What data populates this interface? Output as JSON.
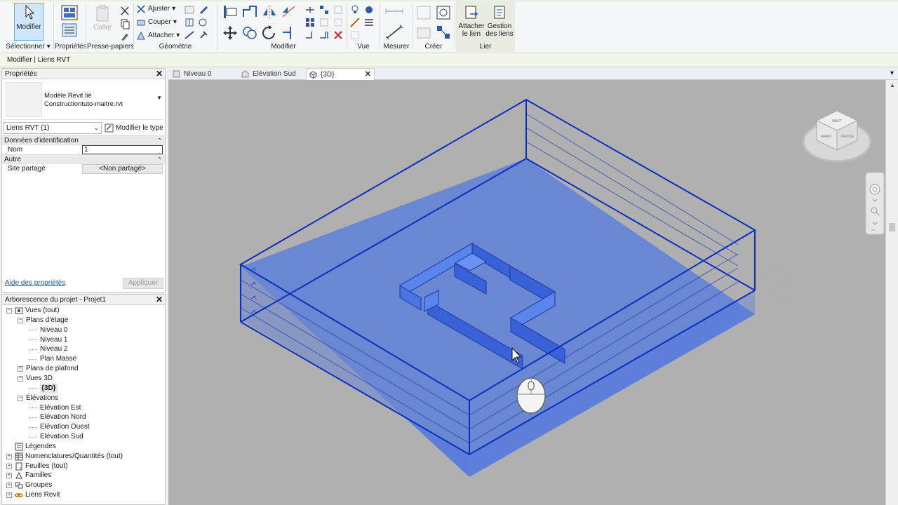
{
  "ribbon": {
    "select": {
      "label": "Modifier",
      "group": "Sélectionner"
    },
    "properties": {
      "group": "Propriétés"
    },
    "clipboard": {
      "paste": "Coller",
      "group": "Presse-papiers"
    },
    "geometry": {
      "items": [
        "Ajuster",
        "Couper",
        "Attacher"
      ],
      "group": "Géométrie"
    },
    "modify": {
      "group": "Modifier"
    },
    "view": {
      "group": "Vue"
    },
    "measure": {
      "group": "Mesurer"
    },
    "create": {
      "group": "Créer"
    },
    "link": {
      "attach": [
        "Attacher",
        "le lien"
      ],
      "manage": [
        "Gestion",
        "des liens"
      ],
      "group": "Lier"
    }
  },
  "context_bar": {
    "text": "Modifier | Liens RVT"
  },
  "properties": {
    "title": "Propriétés",
    "type_name": "Modèle Revit lié",
    "type_file": "Constructiontuto-maitre.rvt",
    "filter": "Liens RVT (1)",
    "edit_type": "Modifier le type",
    "sections": [
      {
        "title": "Données d'identification",
        "rows": [
          {
            "key": "Nom",
            "value": "1",
            "kind": "input"
          }
        ]
      },
      {
        "title": "Autre",
        "rows": [
          {
            "key": "Site partagé",
            "value": "<Non partagé>",
            "kind": "button"
          }
        ]
      }
    ],
    "help": "Aide des propriétés",
    "apply": "Appliquer"
  },
  "browser": {
    "title": "Arborescence du projet - Projet1",
    "items": [
      {
        "label": "Vues (tout)",
        "level": 0,
        "exp": "−",
        "icon": "views-icon"
      },
      {
        "label": "Plans d'étage",
        "level": 1,
        "exp": "−"
      },
      {
        "label": "Niveau 0",
        "level": 2
      },
      {
        "label": "Niveau 1",
        "level": 2
      },
      {
        "label": "Niveau 2",
        "level": 2
      },
      {
        "label": "Plan Masse",
        "level": 2
      },
      {
        "label": "Plans de plafond",
        "level": 1,
        "exp": "+"
      },
      {
        "label": "Vues 3D",
        "level": 1,
        "exp": "−"
      },
      {
        "label": "{3D}",
        "level": 2,
        "selected": true
      },
      {
        "label": "Élévations",
        "level": 1,
        "exp": "−"
      },
      {
        "label": "Elévation Est",
        "level": 2
      },
      {
        "label": "Elévation Nord",
        "level": 2
      },
      {
        "label": "Elévation Ouest",
        "level": 2
      },
      {
        "label": "Elévation Sud",
        "level": 2
      },
      {
        "label": "Légendes",
        "level": 0,
        "exp": "",
        "icon": "legend-icon"
      },
      {
        "label": "Nomenclatures/Quantités (tout)",
        "level": 0,
        "exp": "+",
        "icon": "schedule-icon"
      },
      {
        "label": "Feuilles (tout)",
        "level": 0,
        "exp": "+",
        "icon": "sheet-icon"
      },
      {
        "label": "Familles",
        "level": 0,
        "exp": "+",
        "icon": "family-icon"
      },
      {
        "label": "Groupes",
        "level": 0,
        "exp": "+",
        "icon": "group-icon"
      },
      {
        "label": "Liens Revit",
        "level": 0,
        "exp": "+",
        "icon": "link-icon"
      }
    ]
  },
  "tabs": [
    {
      "label": "Niveau 0",
      "icon": "plan-icon",
      "active": false
    },
    {
      "label": "Elévation Sud",
      "icon": "elevation-icon",
      "active": false
    },
    {
      "label": "{3D}",
      "icon": "3d-view-icon",
      "active": true
    }
  ],
  "viewcube": {
    "top": "HAUT",
    "front": "AVANT",
    "right": "DROITE"
  },
  "colors": {
    "model_edge": "#0a2fbf",
    "model_fill": "#3f6ee8",
    "viewport_bg": "#b0b0b0",
    "context_bar": "#f0f6e8"
  }
}
